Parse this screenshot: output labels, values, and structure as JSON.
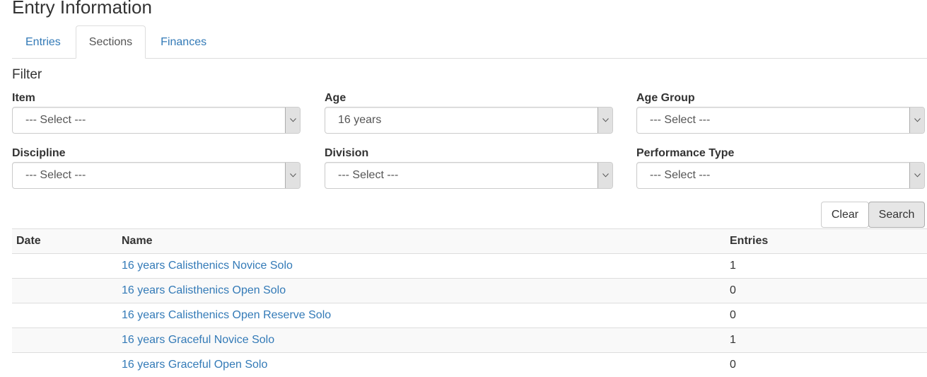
{
  "page": {
    "title": "Entry Information"
  },
  "tabs": [
    {
      "label": "Entries",
      "active": false
    },
    {
      "label": "Sections",
      "active": true
    },
    {
      "label": "Finances",
      "active": false
    }
  ],
  "filter": {
    "heading": "Filter",
    "fields": {
      "item": {
        "label": "Item",
        "value": "--- Select ---"
      },
      "age": {
        "label": "Age",
        "value": "16 years"
      },
      "age_group": {
        "label": "Age Group",
        "value": "--- Select ---"
      },
      "discipline": {
        "label": "Discipline",
        "value": "--- Select ---"
      },
      "division": {
        "label": "Division",
        "value": "--- Select ---"
      },
      "performance_type": {
        "label": "Performance Type",
        "value": "--- Select ---"
      }
    },
    "clear_label": "Clear",
    "search_label": "Search"
  },
  "table": {
    "headers": {
      "date": "Date",
      "name": "Name",
      "entries": "Entries"
    },
    "rows": [
      {
        "date": "",
        "name": "16 years Calisthenics Novice Solo",
        "entries": "1"
      },
      {
        "date": "",
        "name": "16 years Calisthenics Open Solo",
        "entries": "0"
      },
      {
        "date": "",
        "name": "16 years Calisthenics Open Reserve Solo",
        "entries": "0"
      },
      {
        "date": "",
        "name": "16 years Graceful Novice Solo",
        "entries": "1"
      },
      {
        "date": "",
        "name": "16 years Graceful Open Solo",
        "entries": "0"
      }
    ]
  },
  "colors": {
    "link": "#337ab7",
    "text": "#333333",
    "border": "#dddddd",
    "stripe": "#f9f9f9"
  }
}
